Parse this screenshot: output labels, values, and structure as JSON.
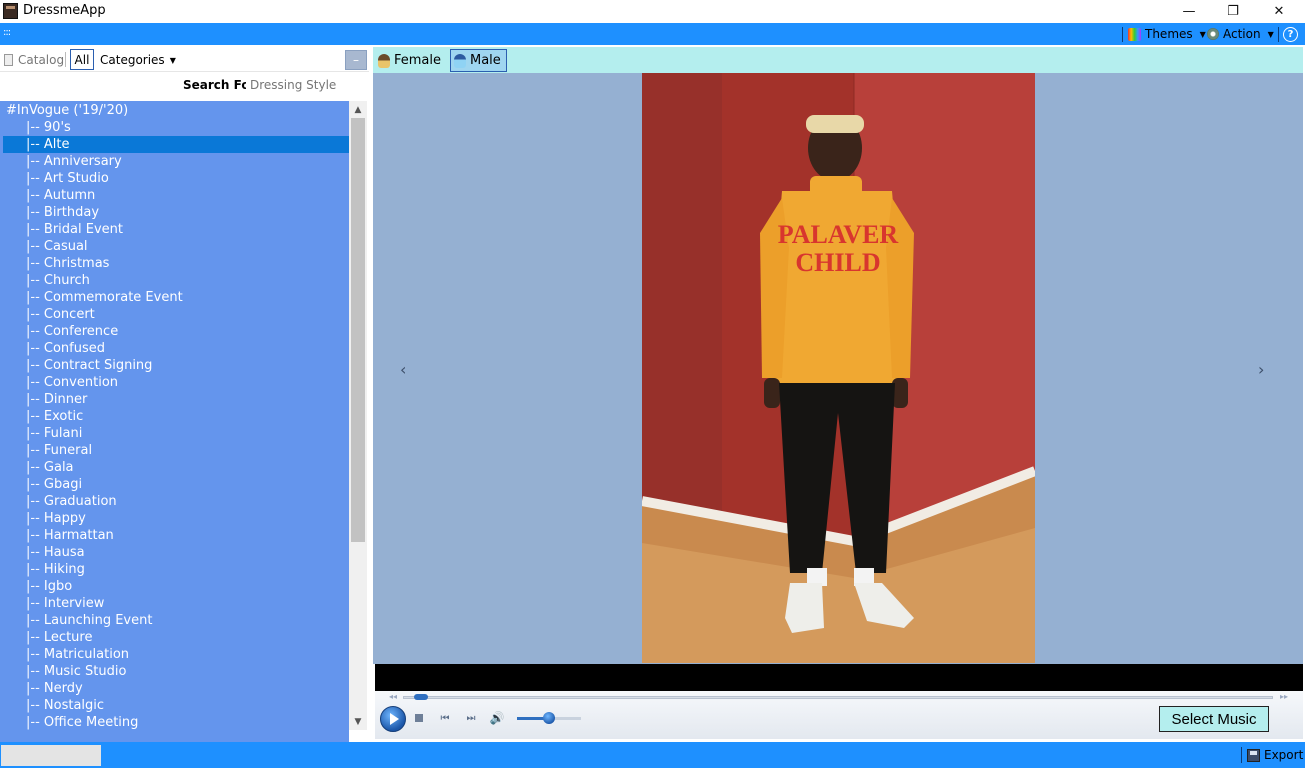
{
  "window": {
    "title": "DressmeApp",
    "controls": {
      "minimize": "—",
      "maximize": "❐",
      "close": "✕"
    }
  },
  "toolbar": {
    "grip": ":::",
    "themes_label": "Themes",
    "action_label": "Action",
    "help_label": "?"
  },
  "left": {
    "catalog_label": "Catalog",
    "all_label": "All",
    "categories_label": "Categories",
    "collapse_label": "–",
    "search_label": "Search For:",
    "search_placeholder": "Dressing Style"
  },
  "tree": {
    "root": "#InVogue ('19/'20)",
    "prefix": "|--",
    "selected_index": 1,
    "items": [
      "90's",
      "Alte",
      "Anniversary",
      "Art Studio",
      "Autumn",
      "Birthday",
      "Bridal Event",
      "Casual",
      "Christmas",
      "Church",
      "Commemorate Event",
      "Concert",
      "Conference",
      "Confused",
      "Contract Signing",
      "Convention",
      "Dinner",
      "Exotic",
      "Fulani",
      "Funeral",
      "Gala",
      "Gbagi",
      "Graduation",
      "Happy",
      "Harmattan",
      "Hausa",
      "Hiking",
      "Igbo",
      "Interview",
      "Launching Event",
      "Lecture",
      "Matriculation",
      "Music Studio",
      "Nerdy",
      "Nostalgic",
      "Office Meeting"
    ]
  },
  "gender_tabs": {
    "female_label": "Female",
    "male_label": "Male",
    "selected": "Male"
  },
  "viewer": {
    "prev_icon": "‹",
    "next_icon": "›",
    "photo_text": [
      "PALAVER",
      "CHILD"
    ]
  },
  "player": {
    "select_music_label": "Select Music",
    "seek_fraction": 0.01,
    "volume_fraction": 0.5
  },
  "status": {
    "export_label": "Export"
  },
  "colors": {
    "accent_blue": "#1e90ff",
    "tree_blue": "#6495ed",
    "tree_selected": "#0a78d7",
    "tab_bar": "#b4eeee",
    "viewer_bg": "#95b0d2"
  }
}
